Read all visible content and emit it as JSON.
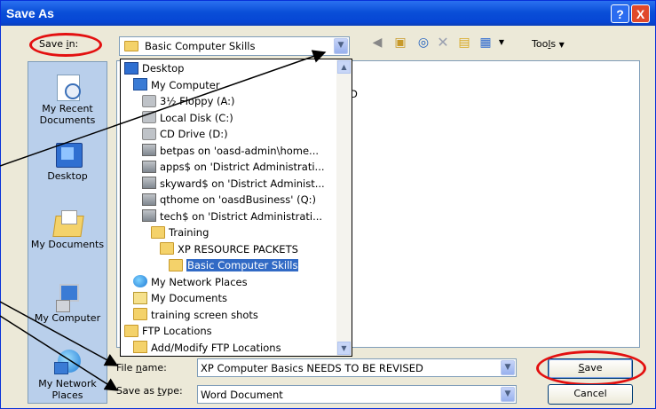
{
  "window": {
    "title": "Save As",
    "help_glyph": "?",
    "close_glyph": "X"
  },
  "save_in": {
    "label_pre": "Save ",
    "label_accel": "i",
    "label_post": "n:",
    "value": "Basic Computer Skills"
  },
  "toolbar": {
    "tools_pre": "Too",
    "tools_accel": "l",
    "tools_post": "s"
  },
  "places": [
    {
      "name": "my-recent-documents",
      "line1": "My Recent",
      "line2": "Documents"
    },
    {
      "name": "desktop",
      "line1": "Desktop",
      "line2": ""
    },
    {
      "name": "my-documents",
      "line1": "My Documents",
      "line2": ""
    },
    {
      "name": "my-computer",
      "line1": "My Computer",
      "line2": ""
    },
    {
      "name": "my-network-places",
      "line1": "My Network",
      "line2": "Places"
    }
  ],
  "filelist": {
    "partial_text": "D"
  },
  "dropdown_items": [
    {
      "label": "Desktop",
      "icon": "desktop-icon"
    },
    {
      "label": "My Computer",
      "icon": "computer-icon"
    },
    {
      "label": "3½ Floppy (A:)",
      "icon": "floppy-icon"
    },
    {
      "label": "Local Disk (C:)",
      "icon": "hard-disk-icon"
    },
    {
      "label": "CD Drive (D:)",
      "icon": "cd-drive-icon"
    },
    {
      "label": "betpas on 'oasd-admin\\home...",
      "icon": "network-drive-icon"
    },
    {
      "label": "apps$ on 'District Administrati...",
      "icon": "network-drive-icon"
    },
    {
      "label": "skyward$ on 'District Administ...",
      "icon": "network-drive-icon"
    },
    {
      "label": "qthome on 'oasdBusiness' (Q:)",
      "icon": "network-drive-icon"
    },
    {
      "label": "tech$ on 'District Administrati...",
      "icon": "network-drive-icon"
    },
    {
      "label": "Training",
      "icon": "folder-icon"
    },
    {
      "label": "XP RESOURCE PACKETS",
      "icon": "folder-icon"
    },
    {
      "label": "Basic Computer Skills",
      "icon": "open-folder-icon"
    },
    {
      "label": "My Network Places",
      "icon": "network-places-icon"
    },
    {
      "label": "My Documents",
      "icon": "documents-icon"
    },
    {
      "label": "training screen shots",
      "icon": "folder-icon"
    },
    {
      "label": "FTP Locations",
      "icon": "folder-icon"
    },
    {
      "label": "Add/Modify FTP Locations",
      "icon": "ftp-icon"
    }
  ],
  "file_name": {
    "label_pre": "File ",
    "label_accel": "n",
    "label_post": "ame:",
    "value": "XP Computer Basics NEEDS TO BE REVISED"
  },
  "save_as_type": {
    "label_pre": "Save as ",
    "label_accel": "t",
    "label_post": "ype:",
    "value": "Word Document"
  },
  "buttons": {
    "save_accel": "S",
    "save_rest": "ave",
    "cancel": "Cancel"
  },
  "colors": {
    "annotation_red": "#e31010",
    "selection": "#316ac5",
    "titlebar": "#0a4fd8"
  }
}
